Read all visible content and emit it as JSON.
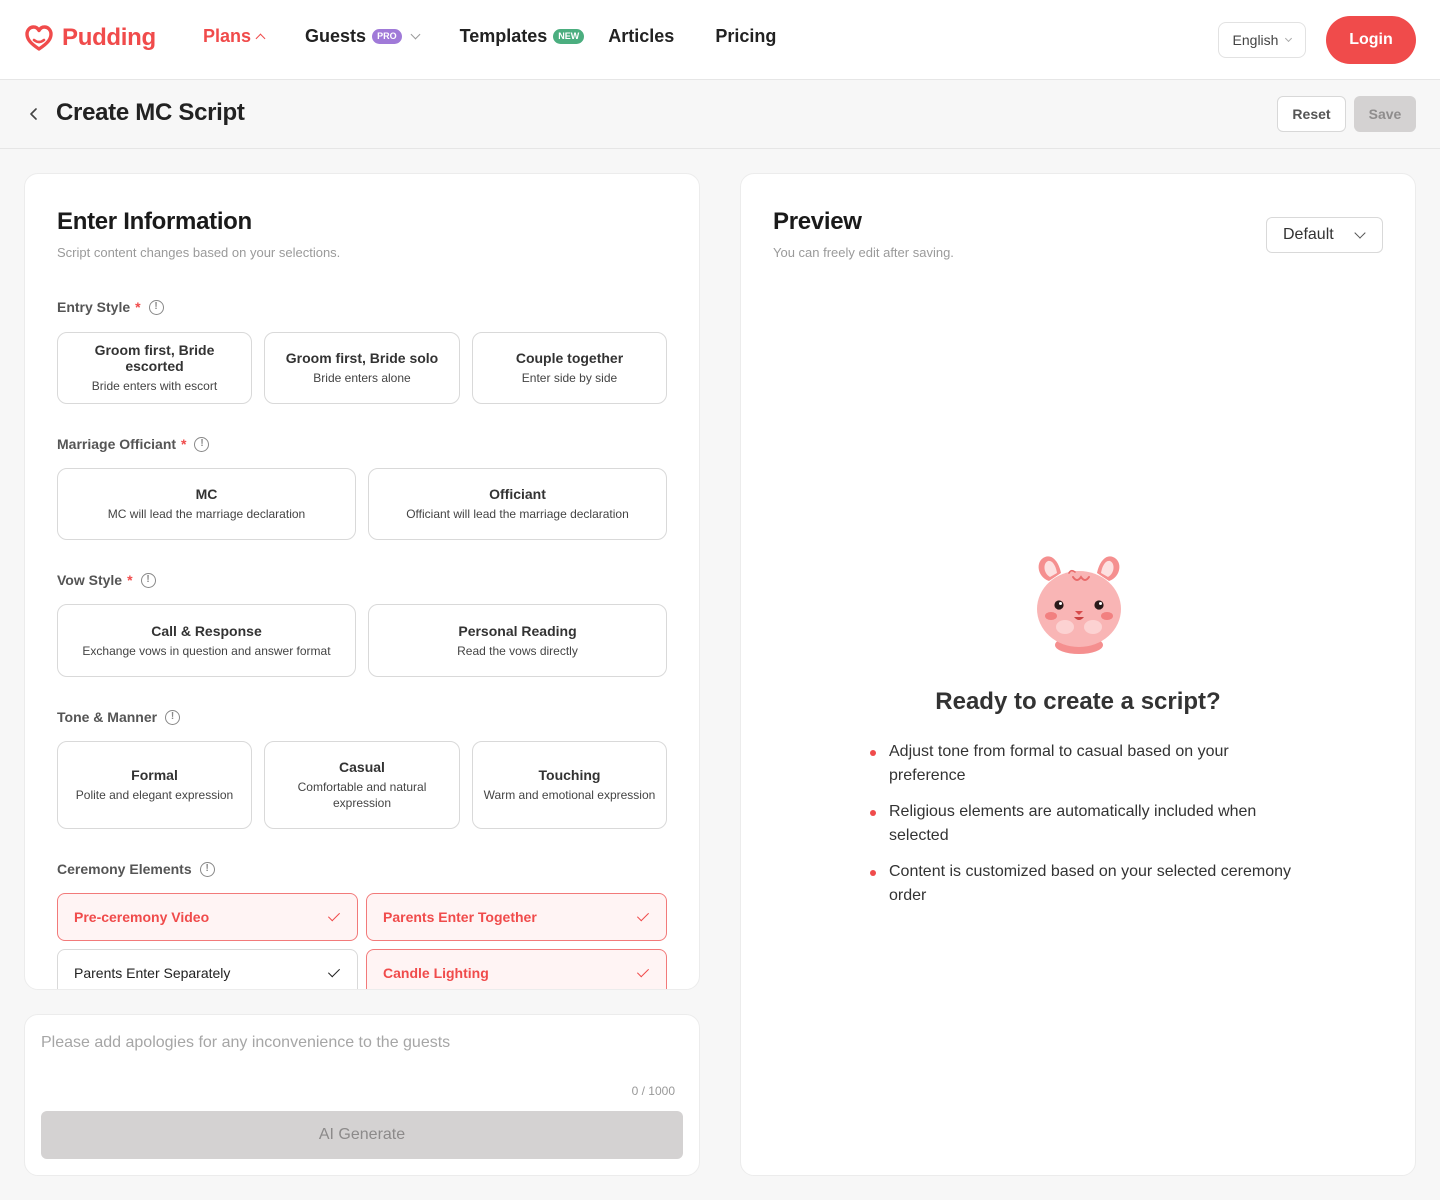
{
  "brand": {
    "name": "Pudding",
    "accent": "#f04b4b"
  },
  "nav": {
    "items": [
      {
        "label": "Plans",
        "badge": "",
        "dropdown": true,
        "active": true
      },
      {
        "label": "Guests",
        "badge": "PRO",
        "dropdown": true,
        "active": false
      },
      {
        "label": "Templates",
        "badge": "NEW",
        "dropdown": false,
        "active": false
      },
      {
        "label": "Articles",
        "badge": "",
        "dropdown": false,
        "active": false
      },
      {
        "label": "Pricing",
        "badge": "",
        "dropdown": false,
        "active": false
      }
    ],
    "language": "English",
    "login_label": "Login"
  },
  "header": {
    "title": "Create MC Script",
    "reset_label": "Reset",
    "save_label": "Save"
  },
  "form": {
    "title": "Enter Information",
    "subtitle": "Script content changes based on your selections.",
    "entry_style": {
      "label": "Entry Style",
      "required": "*",
      "options": [
        {
          "title": "Groom first, Bride escorted",
          "desc": "Bride enters with escort"
        },
        {
          "title": "Groom first, Bride solo",
          "desc": "Bride enters alone"
        },
        {
          "title": "Couple together",
          "desc": "Enter side by side"
        }
      ]
    },
    "officiant": {
      "label": "Marriage Officiant",
      "required": "*",
      "options": [
        {
          "title": "MC",
          "desc": "MC will lead the marriage declaration"
        },
        {
          "title": "Officiant",
          "desc": "Officiant will lead the marriage declaration"
        }
      ]
    },
    "vow_style": {
      "label": "Vow Style",
      "required": "*",
      "options": [
        {
          "title": "Call & Response",
          "desc": "Exchange vows in question and answer format"
        },
        {
          "title": "Personal Reading",
          "desc": "Read the vows directly"
        }
      ]
    },
    "tone": {
      "label": "Tone & Manner",
      "options": [
        {
          "title": "Formal",
          "desc": "Polite and elegant expression"
        },
        {
          "title": "Casual",
          "desc": "Comfortable and natural expression"
        },
        {
          "title": "Touching",
          "desc": "Warm and emotional expression"
        }
      ]
    },
    "ceremony": {
      "label": "Ceremony Elements",
      "items": [
        {
          "label": "Pre-ceremony Video",
          "checked": true
        },
        {
          "label": "Parents Enter Together",
          "checked": true
        },
        {
          "label": "Parents Enter Separately",
          "checked": true
        },
        {
          "label": "Candle Lighting",
          "checked": true
        }
      ]
    }
  },
  "notes": {
    "placeholder": "Please add apologies for any inconvenience to the guests",
    "counter": "0 / 1000",
    "generate_label": "AI Generate"
  },
  "preview": {
    "title": "Preview",
    "subtitle": "You can freely edit after saving.",
    "template": "Default",
    "ready_title": "Ready to create a script?",
    "bullets": [
      "Adjust tone from formal to casual based on your preference",
      "Religious elements are automatically included when selected",
      "Content is customized based on your selected ceremony order"
    ]
  }
}
